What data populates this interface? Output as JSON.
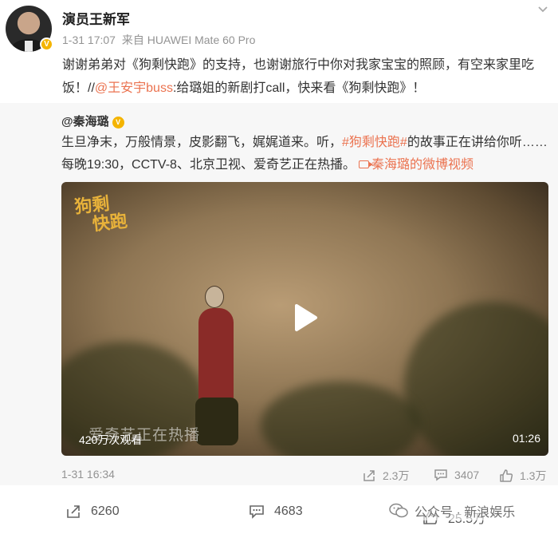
{
  "post": {
    "author": "演员王新军",
    "time": "1-31 17:07",
    "source": "来自 HUAWEI Mate 60 Pro",
    "more_icon": "chevron-down-icon",
    "text_before_mention": "谢谢弟弟对《狗剩快跑》的支持，也谢谢旅行中你对我家宝宝的照顾，有空来家里吃饭！//",
    "mention": "@王安宇buss",
    "text_after_mention": ":给璐姐的新剧打call，快来看《狗剩快跑》！"
  },
  "repost": {
    "author": "@秦海璐",
    "text_part1": "生旦净末，万般情景，皮影翻飞，娓娓道来。听，",
    "hashtag": "#狗剩快跑#",
    "text_part2": "的故事正在讲给你听……每晚19:30，CCTV-8、北京卫视、爱奇艺正在热播。",
    "video_link": "秦海璐的微博视频",
    "video": {
      "logo_line1": "狗剩",
      "logo_line2": "快跑",
      "subtitle": "爱奇艺正在热播",
      "views": "420万次观看",
      "duration": "01:26"
    },
    "time": "1-31 16:34",
    "reposts": "2.3万",
    "comments": "3407",
    "likes": "1.3万"
  },
  "footer": {
    "reposts": "6260",
    "comments": "4683",
    "likes": "25.5万"
  },
  "watermark": {
    "text": "公众号 · 新浪娱乐"
  },
  "colors": {
    "link": "#eb7350",
    "verified": "#f4b400",
    "meta_gray": "#939393"
  }
}
